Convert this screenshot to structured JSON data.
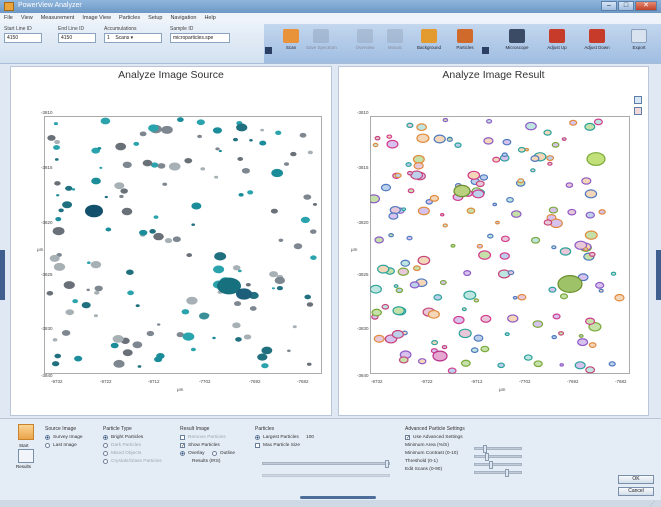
{
  "window": {
    "title": "PowerView Analyzer"
  },
  "menu": [
    "File",
    "View",
    "Measurement",
    "Image View",
    "Particles",
    "Setup",
    "Navigation",
    "Help"
  ],
  "toolbar": {
    "fields": [
      {
        "label": "Start Line ID",
        "value": "4150"
      },
      {
        "label": "End Line ID",
        "value": "4150"
      },
      {
        "label": "Accumulations",
        "value": "1",
        "unit": "Scans"
      },
      {
        "label": "Sample ID",
        "value": "microparticles.spe"
      }
    ],
    "buttons": [
      {
        "label": "Scan",
        "icon": "scan-icon",
        "enabled": true
      },
      {
        "label": "Save Spectrum",
        "icon": "save-spectrum-icon",
        "enabled": false
      },
      {
        "label": "Overview",
        "icon": "overview-icon",
        "enabled": false
      },
      {
        "label": "Mosaic",
        "icon": "mosaic-icon",
        "enabled": false
      },
      {
        "label": "Background",
        "icon": "background-icon",
        "enabled": true
      },
      {
        "label": "Particles",
        "icon": "particles-icon",
        "enabled": true
      },
      {
        "label": "Microscope",
        "icon": "microscope-icon",
        "enabled": true
      },
      {
        "label": "Adjust Up",
        "icon": "adjust-up-icon",
        "enabled": true
      },
      {
        "label": "Adjust Down",
        "icon": "adjust-down-icon",
        "enabled": true
      },
      {
        "label": "Export",
        "icon": "export-icon",
        "enabled": true
      }
    ]
  },
  "panels": {
    "source": {
      "title": "Analyze Image Source",
      "x_ticks": [
        "-9732",
        "-9722",
        "-9712",
        "-7702",
        "-7692",
        "-7682"
      ],
      "y_ticks": [
        "-3810",
        "-3815",
        "-3820",
        "-3825",
        "-3830",
        "-3835",
        "-3840"
      ],
      "x_label": "μm",
      "y_label": "μm"
    },
    "result": {
      "title": "Analyze Image Result",
      "x_ticks": [
        "-9732",
        "-9722",
        "-9712",
        "-7702",
        "-7692",
        "-7682"
      ],
      "y_ticks": [
        "-3810",
        "-3815",
        "-3820",
        "-3825",
        "-3830",
        "-3835",
        "-3840"
      ],
      "x_label": "μm",
      "y_label": "μm"
    }
  },
  "bottom": {
    "left_buttons": [
      "Start",
      "Results"
    ],
    "source_image": {
      "header": "Source Image",
      "options": [
        {
          "label": "Survey Image",
          "selected": true
        },
        {
          "label": "Last Image",
          "selected": false
        }
      ]
    },
    "particle_type": {
      "header": "Particle Type",
      "options": [
        {
          "label": "Bright Particles",
          "selected": true
        },
        {
          "label": "Dark Particles",
          "selected": false
        },
        {
          "label": "Mixed Objects",
          "selected": false
        },
        {
          "label": "Crystals/Glass Particles",
          "selected": false
        }
      ]
    },
    "result_image": {
      "header": "Result Image",
      "options": [
        {
          "label": "Remove Particles",
          "checked": false
        },
        {
          "label": "Show Particles",
          "checked": true
        }
      ],
      "radios": [
        {
          "label": "Overlay",
          "selected": true
        },
        {
          "label": "Outline",
          "selected": false
        }
      ],
      "extra": "Results (IRS)"
    },
    "particles": {
      "header": "Particles",
      "options": [
        {
          "label": "Largest Particles",
          "value": "100",
          "selected": true
        },
        {
          "label": "Max Particle Size",
          "selected": false
        }
      ]
    },
    "advanced": {
      "header": "Advanced Particle Settings",
      "use_label": "Use Advanced Settings",
      "use_checked": true,
      "settings": [
        "Minimum Area (%/S)",
        "Minimum Contrast (0-10)",
        "Threshold (0-1)",
        "Edit Scans (0-90)"
      ]
    },
    "ok_label": "OK",
    "cancel_label": "Cancel"
  },
  "colors": {
    "accent": "#3f6aa6",
    "source_particles": "#1b7f8f",
    "result_outline": "#d83a8e"
  }
}
